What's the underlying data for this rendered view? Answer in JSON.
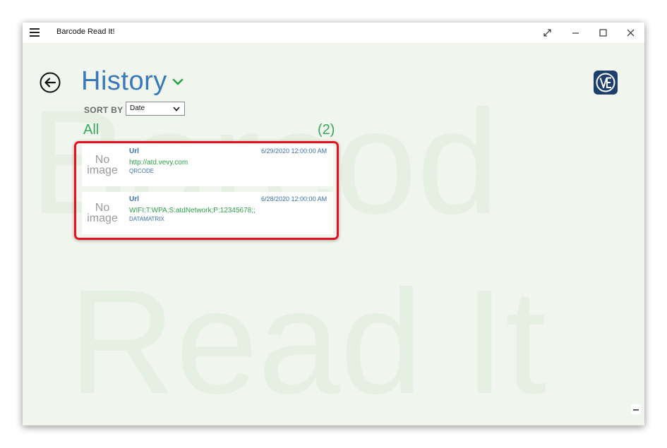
{
  "app": {
    "title": "Barcode Read It!"
  },
  "watermark": {
    "line1": "Barcod",
    "line2": "Read It"
  },
  "header": {
    "title": "History"
  },
  "sort": {
    "label": "SORT BY",
    "selected": "Date"
  },
  "group": {
    "label": "All",
    "count": "(2)"
  },
  "items": [
    {
      "thumb_line1": "No",
      "thumb_line2": "image",
      "title": "Url",
      "date": "6/29/2020 12:00:00 AM",
      "value": "http://atd.vevy.com",
      "type": "QRCODE"
    },
    {
      "thumb_line1": "No",
      "thumb_line2": "image",
      "title": "Url",
      "date": "6/28/2020 12:00:00 AM",
      "value": "WIFI:T:WPA;S:atdNetwork;P:12345678;;",
      "type": "DATAMATRIX"
    }
  ],
  "colors": {
    "accent_blue": "#3a78b8",
    "accent_green": "#3aa85a",
    "highlight_red": "#e8101e",
    "logo_navy": "#1c3f6e"
  },
  "icons": {
    "menu": "hamburger-icon",
    "back": "back-arrow-icon",
    "expand": "expand-icon",
    "minimize": "minimize-icon",
    "maximize": "maximize-icon",
    "close": "close-icon",
    "dropdown": "chevron-down-icon",
    "logo": "ve-logo-icon"
  }
}
